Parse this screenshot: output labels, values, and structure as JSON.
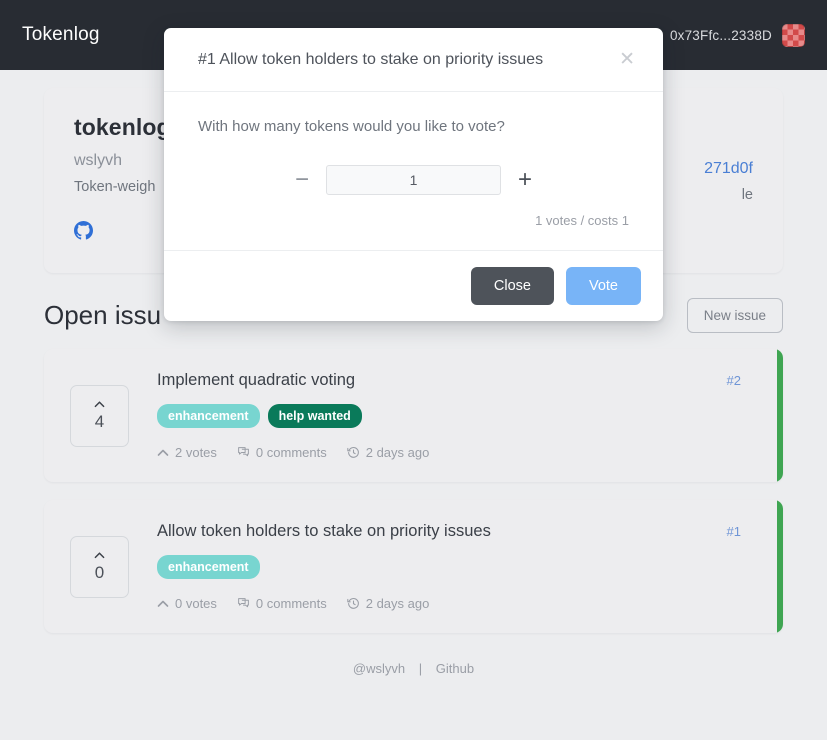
{
  "header": {
    "brand": "Tokenlog",
    "account_address": "0x73Ffc...2338D",
    "avatar_icon": "blockie-avatar"
  },
  "project": {
    "name": "tokenlog",
    "owner": "wslyvh",
    "description": "Token-weigh",
    "github_icon": "github-icon",
    "token_address": "271d0f",
    "token_sub": "le"
  },
  "issues_section": {
    "title": "Open issu",
    "new_issue_label": "New issue",
    "items": [
      {
        "votes_display": "4",
        "title": "Implement quadratic voting",
        "number": "#2",
        "labels": [
          {
            "text": "enhancement",
            "color": "#78d5d0"
          },
          {
            "text": "help wanted",
            "color": "#0a7a5a"
          }
        ],
        "meta": {
          "votes": "2 votes",
          "comments": "0 comments",
          "age": "2 days ago"
        }
      },
      {
        "votes_display": "0",
        "title": "Allow token holders to stake on priority issues",
        "number": "#1",
        "labels": [
          {
            "text": "enhancement",
            "color": "#78d5d0"
          }
        ],
        "meta": {
          "votes": "0 votes",
          "comments": "0 comments",
          "age": "2 days ago"
        }
      }
    ]
  },
  "footer": {
    "handle": "@wslyvh",
    "separator": "|",
    "github": "Github"
  },
  "modal": {
    "title": "#1 Allow token holders to stake on priority issues",
    "close_icon": "close-icon",
    "question": "With how many tokens would you like to vote?",
    "decrement_label": "−",
    "increment_label": "+",
    "amount_value": "1",
    "cost_line": "1 votes / costs 1",
    "close_button": "Close",
    "vote_button": "Vote"
  },
  "colors": {
    "navbar_bg": "#282c33",
    "page_bg": "#ecedef",
    "accent_blue": "#78b4f7",
    "link_blue": "#6f95d6",
    "issue_stripe_green": "#3fa552"
  }
}
